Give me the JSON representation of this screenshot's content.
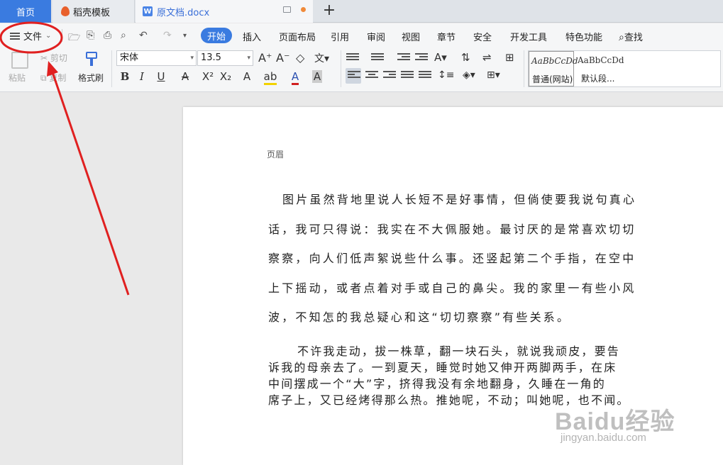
{
  "tabs": {
    "home": "首页",
    "template": "稻壳模板",
    "doc": "原文档.docx"
  },
  "menubar": {
    "file": "文件",
    "ribbon_tabs": [
      "开始",
      "插入",
      "页面布局",
      "引用",
      "审阅",
      "视图",
      "章节",
      "安全",
      "开发工具",
      "特色功能",
      "查找"
    ]
  },
  "toolbar": {
    "paste": "粘贴",
    "cut": "剪切",
    "copy": "复制",
    "format_painter": "格式刷",
    "font_name": "宋体",
    "font_size": "13.5",
    "style_sample_1": "AaBbCcDd",
    "style_sample_2": "AaBbCcDd",
    "style_name_1": "普通(网站)",
    "style_name_2": "默认段..."
  },
  "document": {
    "header_label": "页眉",
    "paragraph1": [
      "图片虽然背地里说人长短不是好事情，但倘使要我说句真心",
      "话，我可只得说：我实在不大佩服她。最讨厌的是常喜欢切切",
      "察察，向人们低声絮说些什么事。还竖起第二个手指，在空中",
      "上下摇动，或者点着对手或自己的鼻尖。我的家里一有些小风",
      "波，不知怎的我总疑心和这“切切察察”有些关系。"
    ],
    "paragraph2": [
      "不许我走动，拔一株草，翻一块石头，就说我顽皮，要告",
      "诉我的母亲去了。一到夏天，睡觉时她又伸开两脚两手，在床",
      "中间摆成一个“大”字，挤得我没有余地翻身，久睡在一角的",
      "席子上，又已经烤得那么热。推她呢，不动；叫她呢，也不闻。"
    ]
  },
  "watermark": {
    "logo": "Baidu经验",
    "url": "jingyan.baidu.com"
  },
  "colors": {
    "accent": "#3a7be0",
    "annotation": "#e02020"
  }
}
